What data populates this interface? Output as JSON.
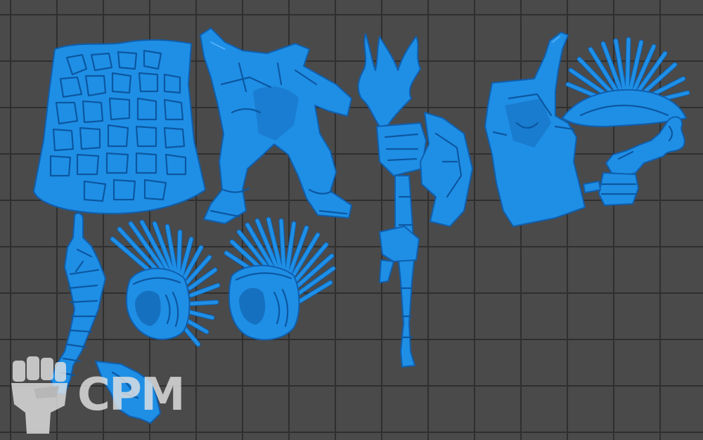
{
  "scene": {
    "background_color": "#4a4a4a",
    "grid_color": "#2f2f2f",
    "model_color": "#1f8fe6"
  },
  "parts": [
    {
      "name": "cobblestone-cloth"
    },
    {
      "name": "warrior-body"
    },
    {
      "name": "flaming-axe"
    },
    {
      "name": "cleaver-blade"
    },
    {
      "name": "crest-top-right"
    },
    {
      "name": "flame-hand"
    },
    {
      "name": "braided-arm"
    },
    {
      "name": "crested-helmet-left"
    },
    {
      "name": "crested-helmet-right"
    },
    {
      "name": "small-flame-piece"
    }
  ],
  "watermark": {
    "text": "CPM",
    "icon": "fist-icon",
    "color": "#e0e0e0"
  }
}
